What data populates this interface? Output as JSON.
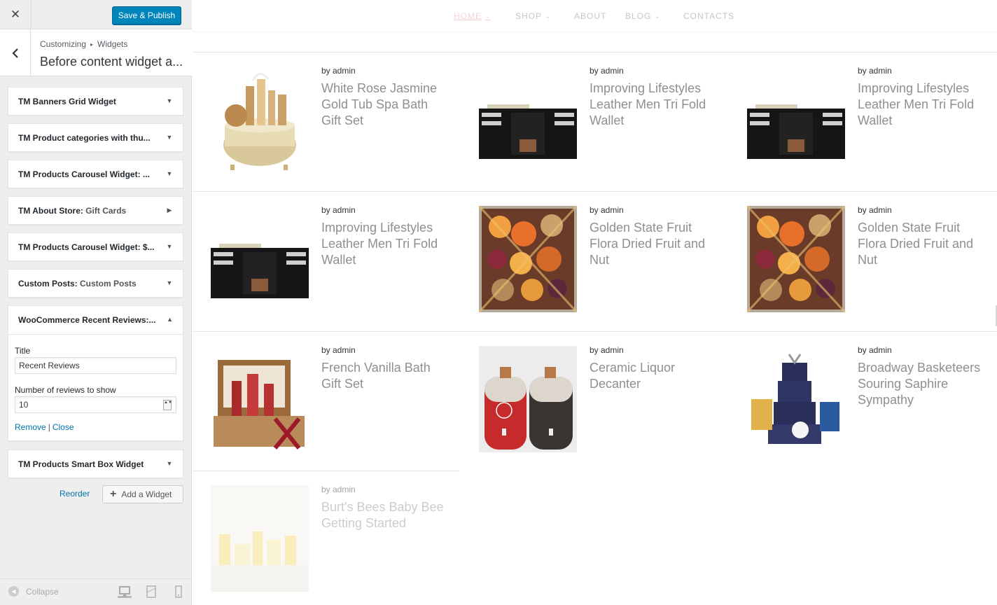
{
  "topbar": {
    "close_glyph": "✕",
    "publish_label": "Save & Publish"
  },
  "section": {
    "crumb_parent": "Customizing",
    "crumb_sep": "▸",
    "crumb_child": "Widgets",
    "title": "Before content widget a..."
  },
  "widgets": [
    {
      "title": "TM Banners Grid Widget",
      "subtitle": "",
      "arrow": "▼"
    },
    {
      "title": "TM Product categories with thu...",
      "subtitle": "",
      "arrow": "▼"
    },
    {
      "title": "TM Products Carousel Widget: ...",
      "subtitle": "",
      "arrow": "▼"
    },
    {
      "title": "TM About Store: ",
      "subtitle": "Gift Cards",
      "arrow": "▶"
    },
    {
      "title": "TM Products Carousel Widget: $...",
      "subtitle": "",
      "arrow": "▼"
    },
    {
      "title": "Custom Posts: ",
      "subtitle": "Custom Posts",
      "arrow": "▼"
    }
  ],
  "open_widget": {
    "title": "WooCommerce Recent Reviews:...",
    "arrow": "▲",
    "title_label": "Title",
    "title_value": "Recent Reviews",
    "count_label": "Number of reviews to show",
    "count_value": "10",
    "spin_glyph": "▲▼",
    "remove_label": "Remove",
    "pipe": "|",
    "close_label": "Close"
  },
  "last_widget": {
    "title": "TM Products Smart Box Widget",
    "arrow": "▼"
  },
  "actions": {
    "reorder_label": "Reorder",
    "add_plus": "+",
    "add_label": "Add a Widget"
  },
  "footer": {
    "collapse_label": "Collapse",
    "collapse_glyph": "◀"
  },
  "nav": {
    "items": [
      {
        "label": "HOME",
        "caret": "⌄"
      },
      {
        "label": "SHOP",
        "caret": "⌄"
      },
      {
        "label": "ABOUT",
        "caret": ""
      },
      {
        "label": "BLOG",
        "caret": "⌄"
      },
      {
        "label": "CONTACTS",
        "caret": ""
      }
    ]
  },
  "posts": [
    {
      "author": "by admin",
      "title": "White Rose Jasmine Gold Tub Spa Bath Gift Set",
      "image": "spa-tub-gift-image"
    },
    {
      "author": "by admin",
      "title": "Improving Lifestyles Leather Men Tri Fold Wallet",
      "image": "wallet-image"
    },
    {
      "author": "by admin",
      "title": "Improving Lifestyles Leather Men Tri Fold Wallet",
      "image": "wallet-image"
    },
    {
      "author": "by admin",
      "title": "Improving Lifestyles Leather Men Tri Fold Wallet",
      "image": "wallet-image"
    },
    {
      "author": "by admin",
      "title": "Golden State Fruit Flora Dried Fruit and Nut",
      "image": "dried-fruit-image"
    },
    {
      "author": "by admin",
      "title": "Golden State Fruit Flora Dried Fruit and Nut",
      "image": "dried-fruit-image"
    },
    {
      "author": "by admin",
      "title": "French Vanilla Bath Gift Set",
      "image": "vanilla-bath-image"
    },
    {
      "author": "by admin",
      "title": "Ceramic Liquor Decanter",
      "image": "decanter-image"
    },
    {
      "author": "by admin",
      "title": "Broadway Basketeers Souring Saphire Sympathy",
      "image": "gift-tower-image"
    },
    {
      "author": "by admin",
      "title": "Burt's Bees Baby Bee Getting Started",
      "image": "baby-bee-image"
    }
  ]
}
